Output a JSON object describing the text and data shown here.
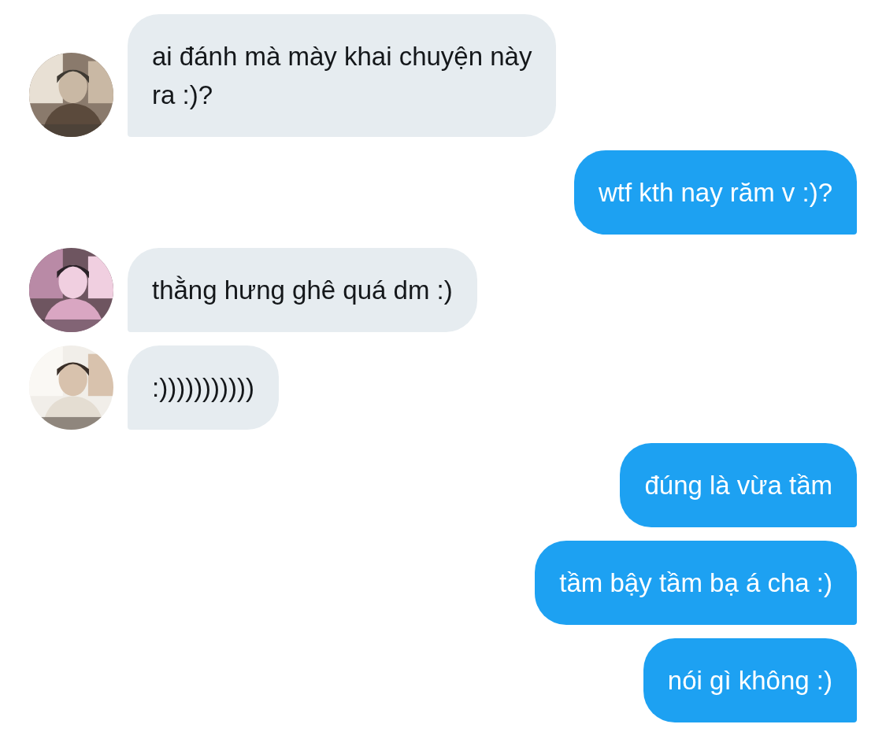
{
  "messages": [
    {
      "kind": "incoming",
      "text": "ai đánh mà mày khai chuyện này\nra :)?"
    },
    {
      "kind": "outgoing",
      "text": "wtf kth nay răm v :)?"
    },
    {
      "kind": "incoming",
      "text": "thằng hưng ghê quá dm :)"
    },
    {
      "kind": "incoming",
      "text": ":)))))))))))"
    },
    {
      "kind": "outgoing",
      "text": "đúng là vừa tầm"
    },
    {
      "kind": "outgoing",
      "text": "tầm bậy tầm bạ á cha :)"
    },
    {
      "kind": "outgoing",
      "text": "nói gì không :)"
    }
  ]
}
